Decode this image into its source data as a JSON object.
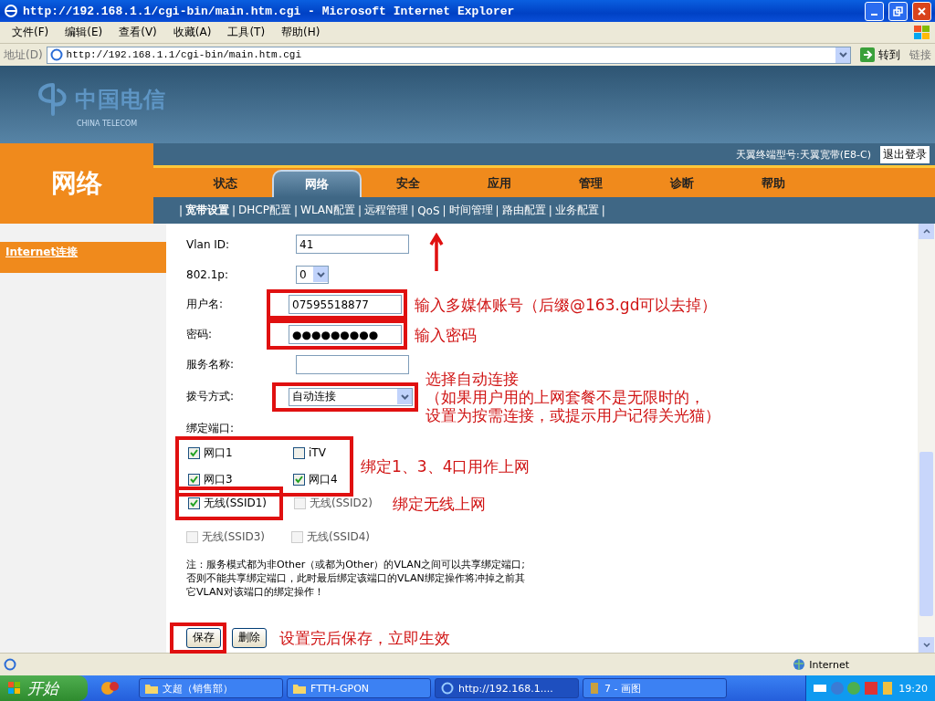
{
  "window": {
    "title": "http://192.168.1.1/cgi-bin/main.htm.cgi - Microsoft Internet Explorer"
  },
  "menu": [
    "文件(F)",
    "编辑(E)",
    "查看(V)",
    "收藏(A)",
    "工具(T)",
    "帮助(H)"
  ],
  "address_bar": {
    "label": "地址(D)",
    "value": "http://192.168.1.1/cgi-bin/main.htm.cgi",
    "go": "转到",
    "links": "链接"
  },
  "header": {
    "logo_cn": "中国电信",
    "logo_en": "CHINA TELECOM",
    "section": "网络",
    "model": "天翼终端型号:天翼宽带(E8-C)",
    "logout": "退出登录"
  },
  "tabs": [
    {
      "label": "状态",
      "selected": false
    },
    {
      "label": "网络",
      "selected": true
    },
    {
      "label": "安全",
      "selected": false
    },
    {
      "label": "应用",
      "selected": false
    },
    {
      "label": "管理",
      "selected": false
    },
    {
      "label": "诊断",
      "selected": false
    },
    {
      "label": "帮助",
      "selected": false
    }
  ],
  "subtab_separator": "|",
  "subtabs": [
    {
      "label": "宽带设置",
      "selected": true
    },
    {
      "label": "DHCP配置",
      "selected": false
    },
    {
      "label": "WLAN配置",
      "selected": false
    },
    {
      "label": "远程管理",
      "selected": false
    },
    {
      "label": "QoS",
      "selected": false
    },
    {
      "label": "时间管理",
      "selected": false
    },
    {
      "label": "路由配置",
      "selected": false
    },
    {
      "label": "业务配置",
      "selected": false
    }
  ],
  "sidebar": {
    "items": [
      {
        "label": "Internet连接",
        "selected": true
      }
    ]
  },
  "form": {
    "fields": [
      {
        "kind": "input",
        "label": "Vlan ID:",
        "value": "41"
      },
      {
        "kind": "select",
        "label": "802.1p:",
        "value": "0"
      },
      {
        "kind": "input",
        "label": "用户名:",
        "value": "07595518877",
        "highlighted": true,
        "note": [
          "输入多媒体账号（后缀@163.gd可以去掉）"
        ]
      },
      {
        "kind": "input",
        "label": "密码:",
        "value": "●●●●●●●●●",
        "highlighted": true,
        "note": [
          "输入密码"
        ]
      },
      {
        "kind": "input",
        "label": "服务名称:"
      },
      {
        "kind": "wideselect",
        "label": "拨号方式:",
        "value": "自动连接",
        "highlighted": true,
        "note": [
          "选择自动连接",
          "（如果用户用的上网套餐不是无限时的，",
          "设置为按需连接，或提示用户记得关光猫）"
        ]
      },
      {
        "kind": "label",
        "label": "绑定端口:"
      }
    ],
    "port_groups": [
      {
        "note": "绑定1、3、4口用作上网",
        "framed_ports": [
          {
            "label": "网口1",
            "checked": true,
            "disabled": false
          },
          {
            "label": "iTV",
            "checked": false,
            "disabled": false
          },
          {
            "label": "网口3",
            "checked": true,
            "disabled": false
          },
          {
            "label": "网口4",
            "checked": true,
            "disabled": false
          }
        ]
      },
      {
        "note": "绑定无线上网",
        "framed_ports": [
          {
            "label": "无线(SSID1)",
            "checked": true,
            "disabled": false
          }
        ],
        "ports": [
          {
            "label": "无线(SSID2)",
            "checked": false,
            "disabled": true
          }
        ]
      },
      {
        "ports": [
          {
            "label": "无线(SSID3)",
            "checked": false,
            "disabled": true
          },
          {
            "label": "无线(SSID4)",
            "checked": false,
            "disabled": true
          }
        ]
      }
    ],
    "remark": [
      "注：服务模式都为非Other（或都为Other）的VLAN之间可以共享绑定端口;",
      "否则不能共享绑定端口，此时最后绑定该端口的VLAN绑定操作将冲掉之前其",
      "它VLAN对该端口的绑定操作！"
    ],
    "buttons": [
      {
        "label": "保存",
        "highlighted": true
      },
      {
        "label": "删除"
      }
    ],
    "buttons_note": "设置完后保存，立即生效"
  },
  "status_bar": {
    "zone": "Internet"
  },
  "taskbar": {
    "start": "开始",
    "tasks": [
      {
        "label": "文超（销售部）",
        "kind": "folder",
        "selected": false
      },
      {
        "label": "FTTH-GPON",
        "kind": "folder",
        "selected": false
      },
      {
        "label": "http://192.168.1....",
        "kind": "browser",
        "selected": true
      },
      {
        "label": "7 - 画图",
        "kind": "paint",
        "selected": false
      }
    ],
    "clock": "19:20"
  }
}
